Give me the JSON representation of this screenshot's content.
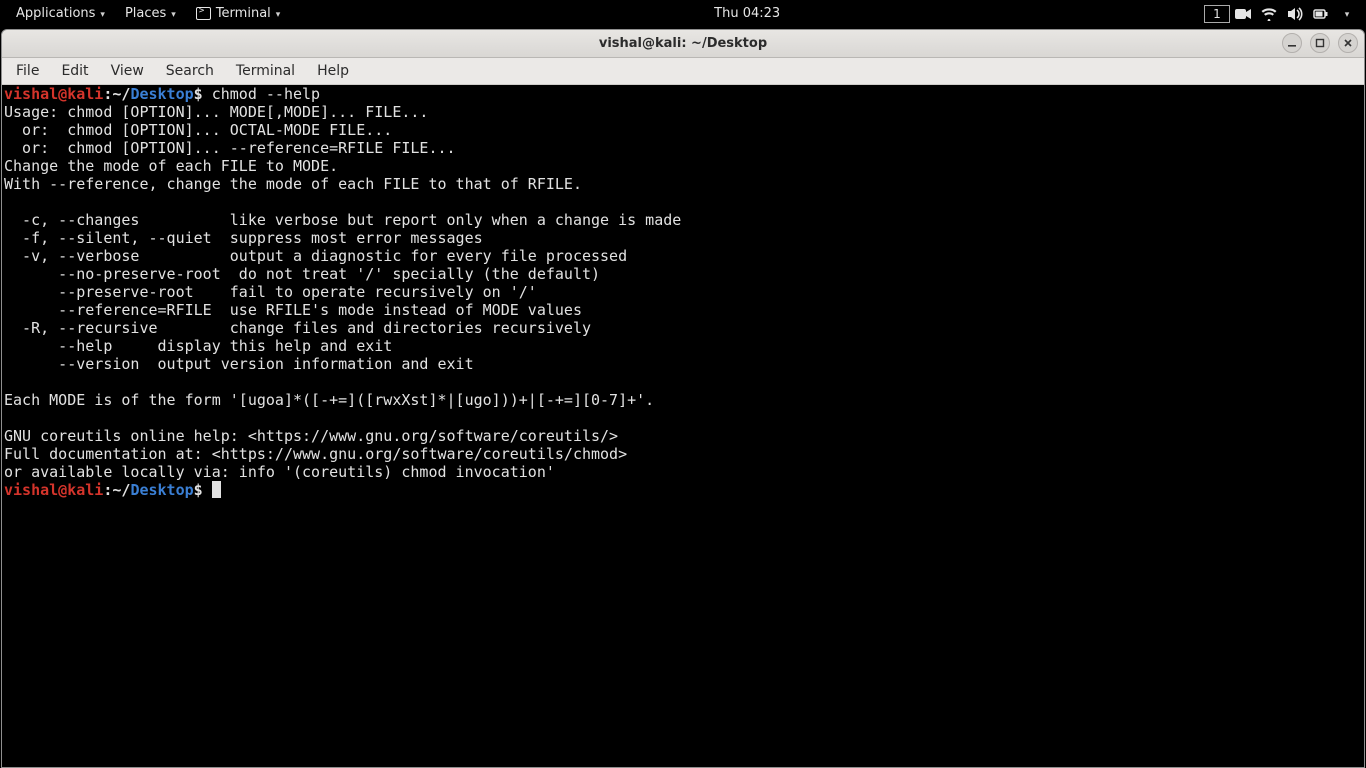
{
  "topbar": {
    "applications": "Applications",
    "places": "Places",
    "terminal_label": "Terminal",
    "clock": "Thu 04:23",
    "workspace": "1"
  },
  "window": {
    "title": "vishal@kali: ~/Desktop",
    "menus": {
      "file": "File",
      "edit": "Edit",
      "view": "View",
      "search": "Search",
      "terminal": "Terminal",
      "help": "Help"
    }
  },
  "prompt": {
    "user": "vishal",
    "host": "kali",
    "path": "Desktop",
    "command1": "chmod --help",
    "command2": ""
  },
  "output_lines": [
    "Usage: chmod [OPTION]... MODE[,MODE]... FILE...",
    "  or:  chmod [OPTION]... OCTAL-MODE FILE...",
    "  or:  chmod [OPTION]... --reference=RFILE FILE...",
    "Change the mode of each FILE to MODE.",
    "With --reference, change the mode of each FILE to that of RFILE.",
    "",
    "  -c, --changes          like verbose but report only when a change is made",
    "  -f, --silent, --quiet  suppress most error messages",
    "  -v, --verbose          output a diagnostic for every file processed",
    "      --no-preserve-root  do not treat '/' specially (the default)",
    "      --preserve-root    fail to operate recursively on '/'",
    "      --reference=RFILE  use RFILE's mode instead of MODE values",
    "  -R, --recursive        change files and directories recursively",
    "      --help     display this help and exit",
    "      --version  output version information and exit",
    "",
    "Each MODE is of the form '[ugoa]*([-+=]([rwxXst]*|[ugo]))+|[-+=][0-7]+'.",
    "",
    "GNU coreutils online help: <https://www.gnu.org/software/coreutils/>",
    "Full documentation at: <https://www.gnu.org/software/coreutils/chmod>",
    "or available locally via: info '(coreutils) chmod invocation'"
  ]
}
